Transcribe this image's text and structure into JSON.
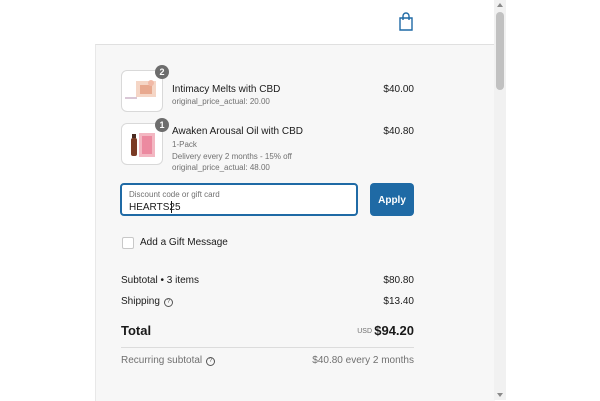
{
  "header": {
    "cart_icon": "shopping-bag-icon"
  },
  "items": [
    {
      "name": "Intimacy Melts with CBD",
      "quantity": "2",
      "details": [
        "original_price_actual: 20.00"
      ],
      "price": "$40.00"
    },
    {
      "name": "Awaken Arousal Oil with CBD",
      "quantity": "1",
      "details": [
        "1-Pack",
        "Delivery every 2 months - 15% off",
        "original_price_actual: 48.00"
      ],
      "price": "$40.80"
    }
  ],
  "discount": {
    "placeholder": "Discount code or gift card",
    "value": "HEARTS25",
    "apply_label": "Apply"
  },
  "gift": {
    "label": "Add a Gift Message",
    "checked": false
  },
  "summary": {
    "subtotal_label": "Subtotal • 3 items",
    "subtotal_value": "$80.80",
    "shipping_label": "Shipping",
    "shipping_value": "$13.40",
    "total_label": "Total",
    "total_currency": "USD",
    "total_value": "$94.20",
    "recurring_label": "Recurring subtotal",
    "recurring_value": "$40.80 every 2 months"
  },
  "colors": {
    "accent": "#1f6aa5",
    "panel_bg": "#f7f7f7",
    "muted_text": "#707070"
  }
}
